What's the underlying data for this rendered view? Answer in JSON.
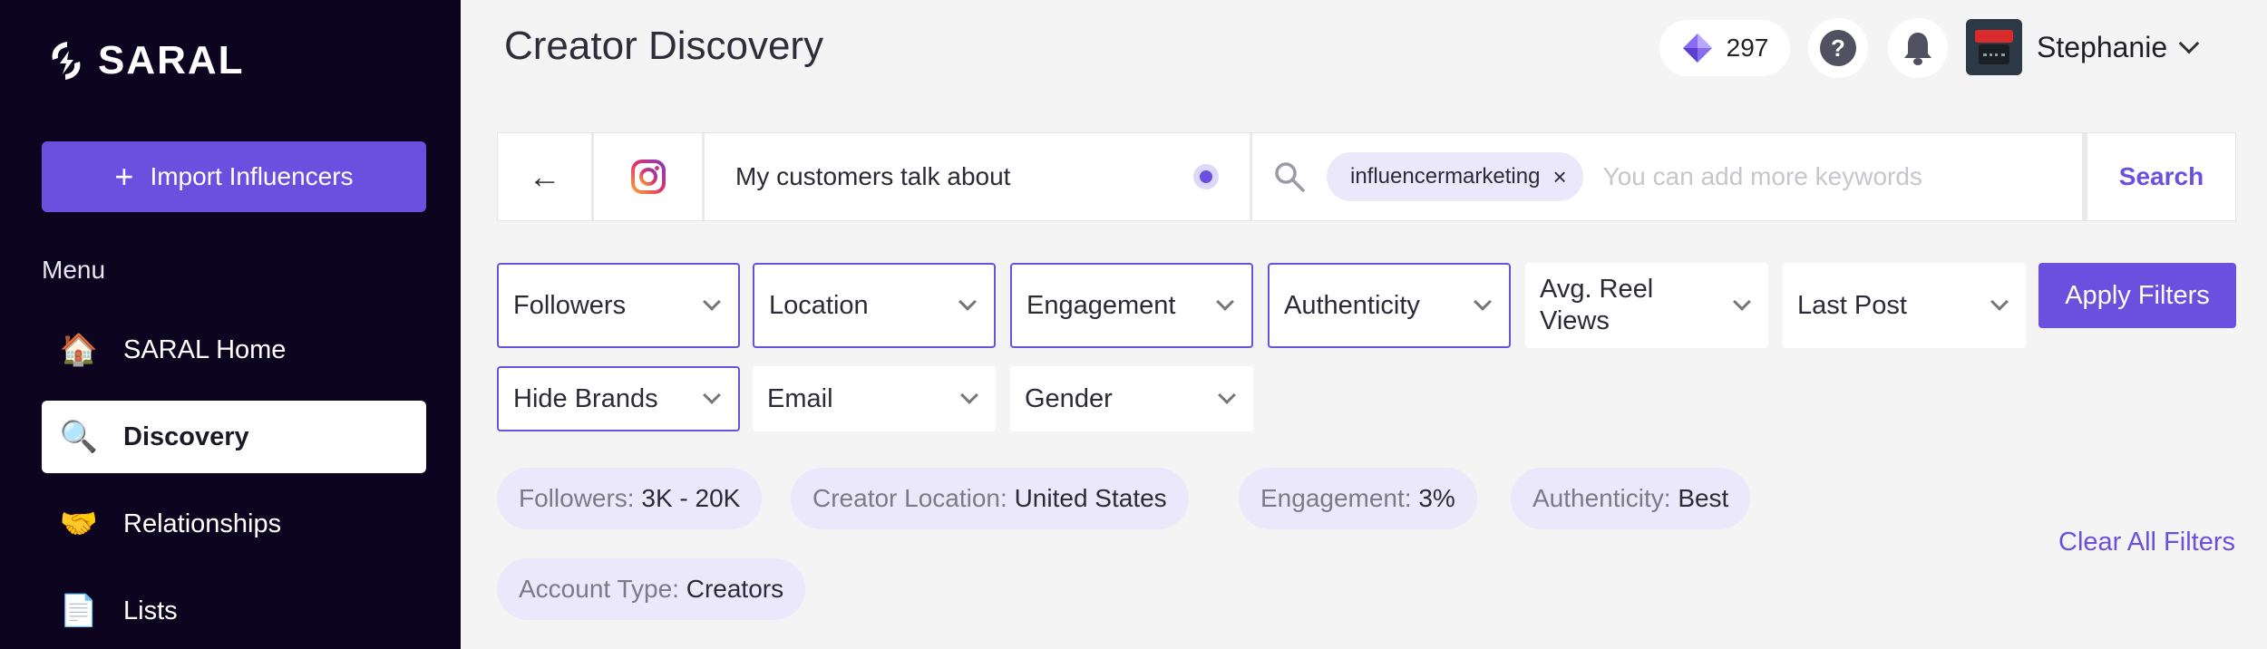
{
  "brand": {
    "name": "SARAL",
    "logo_icon": "saral-logo-icon"
  },
  "sidebar": {
    "import_button": {
      "icon": "plus-icon",
      "label": "Import Influencers"
    },
    "menu_label": "Menu",
    "items": [
      {
        "label": "SARAL Home",
        "icon": "house-icon",
        "glyph": "🏠",
        "active": false
      },
      {
        "label": "Discovery",
        "icon": "magnifier-icon",
        "glyph": "🔍",
        "active": true
      },
      {
        "label": "Relationships",
        "icon": "handshake-icon",
        "glyph": "🤝",
        "active": false
      },
      {
        "label": "Lists",
        "icon": "document-icon",
        "glyph": "📄",
        "active": false
      }
    ]
  },
  "header": {
    "title": "Creator Discovery",
    "credits": "297",
    "user_name": "Stephanie"
  },
  "search": {
    "back_glyph": "←",
    "query_mode": "My customers talk about",
    "keyword_chip": "influencermarketing",
    "remove_glyph": "×",
    "placeholder": "You can add more keywords",
    "search_label": "Search"
  },
  "filters": {
    "followers": "Followers",
    "location": "Location",
    "engagement": "Engagement",
    "authenticity": "Authenticity",
    "avg_reel_views": "Avg. Reel Views",
    "last_post": "Last Post",
    "hide_brands": "Hide Brands",
    "email": "Email",
    "gender": "Gender",
    "apply_label": "Apply Filters"
  },
  "applied": [
    {
      "key": "Followers:",
      "value": "3K - 20K"
    },
    {
      "key": "Creator Location:",
      "value": "United States"
    },
    {
      "key": "Engagement:",
      "value": "3%"
    },
    {
      "key": "Authenticity:",
      "value": "Best"
    },
    {
      "key": "Account Type:",
      "value": "Creators"
    }
  ],
  "clear_all_label": "Clear All Filters",
  "colors": {
    "accent": "#6b50e0",
    "sidebar_bg": "#0d0520",
    "chip_bg": "#ebe8fb"
  }
}
